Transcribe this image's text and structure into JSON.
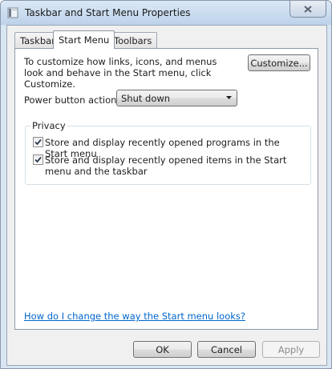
{
  "window": {
    "title": "Taskbar and Start Menu Properties"
  },
  "tabs": [
    {
      "label": "Taskbar",
      "active": false
    },
    {
      "label": "Start Menu",
      "active": true
    },
    {
      "label": "Toolbars",
      "active": false
    }
  ],
  "start_menu": {
    "description": "To customize how links, icons, and menus look and behave in the Start menu, click Customize.",
    "customize_label": "Customize...",
    "power_button_label": "Power button action:",
    "power_button_value": "Shut down",
    "privacy": {
      "title": "Privacy",
      "options": [
        {
          "label": "Store and display recently opened programs in the Start menu",
          "checked": true
        },
        {
          "label": "Store and display recently opened items in the Start menu and the taskbar",
          "checked": true
        }
      ]
    },
    "help_link": "How do I change the way the Start menu looks?"
  },
  "footer": {
    "ok_label": "OK",
    "cancel_label": "Cancel",
    "apply_label": "Apply",
    "apply_enabled": false
  },
  "icons": {
    "app": "taskbar-app-icon",
    "close": "close-icon",
    "dropdown": "chevron-down-icon",
    "check": "checkmark-icon"
  },
  "colors": {
    "link": "#0066cc",
    "titlebar": "#c4d8ee",
    "panel_border": "#8e99a6"
  }
}
